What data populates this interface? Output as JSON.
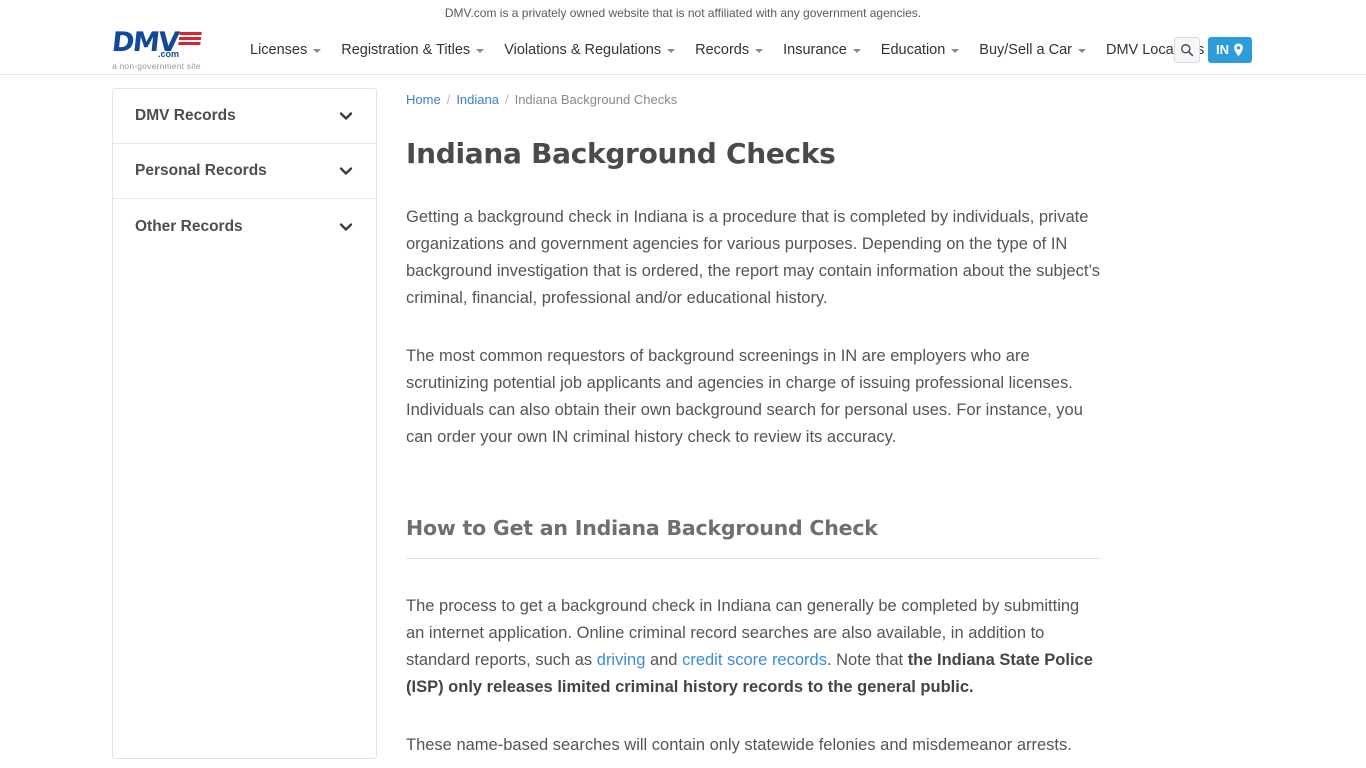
{
  "topbar": {
    "disclaimer": "DMV.com is a privately owned website that is not affiliated with any government agencies."
  },
  "header": {
    "logo": {
      "wordmark": "DMV",
      "dotcom": ".com",
      "tagline": "a non-government site"
    },
    "nav": [
      {
        "label": "Licenses",
        "has_caret": true
      },
      {
        "label": "Registration & Titles",
        "has_caret": true
      },
      {
        "label": "Violations & Regulations",
        "has_caret": true
      },
      {
        "label": "Records",
        "has_caret": true
      },
      {
        "label": "Insurance",
        "has_caret": true
      },
      {
        "label": "Education",
        "has_caret": true
      },
      {
        "label": "Buy/Sell a Car",
        "has_caret": true
      },
      {
        "label": "DMV Locations",
        "has_caret": false
      }
    ],
    "search_icon": "search-icon",
    "state_selector": {
      "label": "IN",
      "icon": "map-pin-icon",
      "color": "#2c9cdb"
    }
  },
  "sidebar": {
    "items": [
      {
        "label": "DMV Records",
        "icon": "chevron-down-icon"
      },
      {
        "label": "Personal Records",
        "icon": "chevron-down-icon"
      },
      {
        "label": "Other Records",
        "icon": "chevron-down-icon"
      }
    ]
  },
  "breadcrumb": {
    "home": "Home",
    "state": "Indiana",
    "current": "Indiana Background Checks",
    "separator": "/"
  },
  "main": {
    "title": "Indiana Background Checks",
    "paragraph_1": "Getting a background check in Indiana is a procedure that is completed by individuals, private organizations and government agencies for various purposes. Depending on the type of IN background investigation that is ordered, the report may contain information about the subject’s criminal, financial, professional and/or educational history.",
    "paragraph_2": "The most common requestors of background screenings in IN are employers who are scrutinizing potential job applicants and agencies in charge of issuing professional licenses. Individuals can also obtain their own background search for personal uses. For instance, you can order your own IN criminal history check to review its accuracy.",
    "section_title": "How to Get an Indiana Background Check",
    "paragraph_3": {
      "part_1": "The process to get a background check in Indiana can generally be completed by submitting an internet application. Online criminal record searches are also available, in addition to standard reports, such as ",
      "link_1": "driving",
      "part_2": " and ",
      "link_2": "credit score records",
      "part_3": ". Note that ",
      "bold_1": "the Indiana State Police (ISP) only releases limited criminal history records to the general public."
    },
    "paragraph_4": "These name-based searches will contain only statewide felonies and misdemeanor arrests."
  },
  "colors": {
    "link": "#3b8cdb",
    "brand_blue": "#13499a",
    "brand_red": "#d7262d",
    "accent": "#2c9cdb",
    "body_text": "#555555"
  }
}
